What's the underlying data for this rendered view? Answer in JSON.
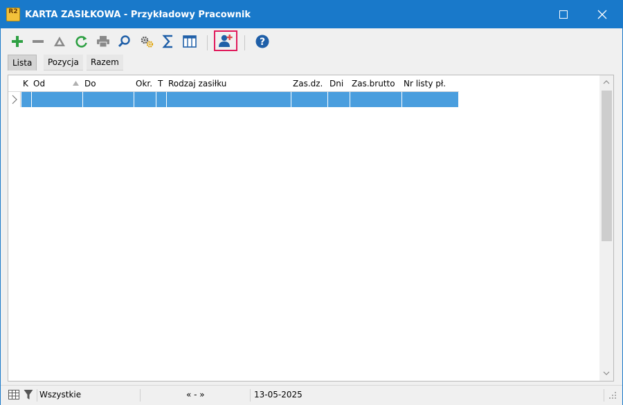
{
  "window": {
    "title": "KARTA ZASIŁKOWA - Przykładowy Pracownik",
    "app_icon_label": "R2"
  },
  "toolbar": {
    "items": [
      "plus-icon",
      "minus-icon",
      "warning-triangle-icon",
      "refresh-icon",
      "print-icon",
      "search-icon",
      "settings-gears-icon",
      "sum-sigma-icon",
      "columns-icon",
      "add-employee-icon",
      "help-icon"
    ]
  },
  "tabs": [
    {
      "label": "Lista",
      "active": true
    },
    {
      "label": "Pozycja",
      "active": false
    },
    {
      "label": "Razem",
      "active": false
    }
  ],
  "table": {
    "columns": [
      "K",
      "Od",
      "Do",
      "Okr.",
      "T",
      "Rodzaj zasiłku",
      "Zas.dz.",
      "Dni",
      "Zas.brutto",
      "Nr listy pł."
    ],
    "rows": [
      [
        "",
        "",
        "",
        "",
        "",
        "",
        "",
        "",
        "",
        ""
      ]
    ]
  },
  "statusbar": {
    "filter": "Wszystkie",
    "nav": "« - »",
    "date": "13-05-2025"
  },
  "colors": {
    "titlebar": "#1979ca",
    "selection": "#4a9ede",
    "highlight_border": "#e0185a"
  }
}
